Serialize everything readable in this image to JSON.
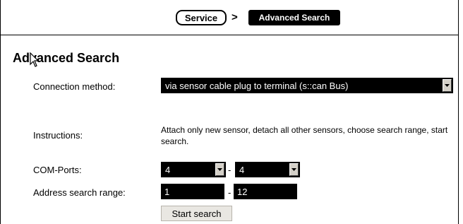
{
  "breadcrumb": {
    "service_label": "Service",
    "separator": ">",
    "current_label": "Advanced Search"
  },
  "page": {
    "title": "Advanced Search"
  },
  "form": {
    "connection_method": {
      "label": "Connection method:",
      "value": "via sensor cable plug to terminal (s::can Bus)"
    },
    "instructions": {
      "label": "Instructions:",
      "text": "Attach only new sensor, detach all other sensors, choose search range, start search."
    },
    "com_ports": {
      "label": "COM-Ports:",
      "from_value": "4",
      "separator": "-",
      "to_value": "4"
    },
    "address_range": {
      "label": "Address search range:",
      "from_value": "1",
      "separator": "-",
      "to_value": "12"
    },
    "start_button_label": "Start search"
  }
}
